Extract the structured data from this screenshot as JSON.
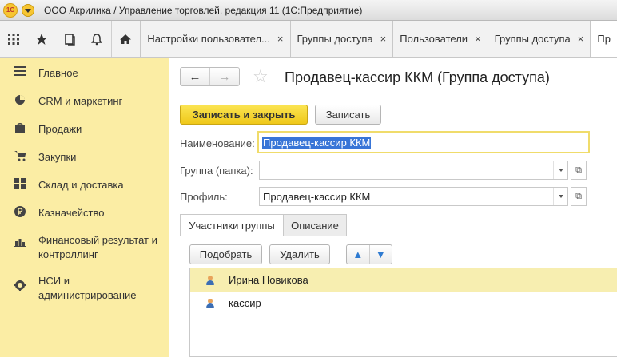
{
  "window": {
    "logo_text": "1С",
    "title": "ООО Акрилика / Управление торговлей, редакция 11  (1С:Предприятие)"
  },
  "toolbar": {
    "icons": [
      "apps-grid-icon",
      "star-icon",
      "history-icon",
      "bell-icon",
      "home-icon"
    ],
    "tabs": [
      {
        "label": "Настройки пользовател...",
        "close": "×"
      },
      {
        "label": "Группы доступа",
        "close": "×"
      },
      {
        "label": "Пользователи",
        "close": "×"
      },
      {
        "label": "Группы доступа",
        "close": "×"
      },
      {
        "label": "Пр",
        "close": ""
      }
    ]
  },
  "sidebar": {
    "items": [
      {
        "label": "Главное",
        "icon": "menu-icon"
      },
      {
        "label": "CRM и маркетинг",
        "icon": "pie-chart-icon"
      },
      {
        "label": "Продажи",
        "icon": "bag-icon"
      },
      {
        "label": "Закупки",
        "icon": "cart-icon"
      },
      {
        "label": "Склад и доставка",
        "icon": "warehouse-icon"
      },
      {
        "label": "Казначейство",
        "icon": "ruble-icon"
      },
      {
        "label": "Финансовый результат и контроллинг",
        "icon": "bar-chart-icon"
      },
      {
        "label": "НСИ и администрирование",
        "icon": "gear-icon"
      }
    ]
  },
  "form": {
    "title": "Продавец-кассир ККМ (Группа доступа)",
    "save_close_label": "Записать и закрыть",
    "save_label": "Записать",
    "name_label": "Наименование:",
    "name_value": "Продавец-кассир ККМ",
    "group_label": "Группа (папка):",
    "group_value": "",
    "profile_label": "Профиль:",
    "profile_value": "Продавец-кассир ККМ",
    "tabs": [
      "Участники группы",
      "Описание"
    ],
    "pick_label": "Подобрать",
    "delete_label": "Удалить",
    "members": [
      "Ирина Новикова",
      "кассир"
    ]
  },
  "colors": {
    "sidebar_bg": "#fbeda4",
    "primary_button": "#f5d633",
    "selected_row": "#f7eeb0",
    "text_selection": "#3875d7"
  }
}
